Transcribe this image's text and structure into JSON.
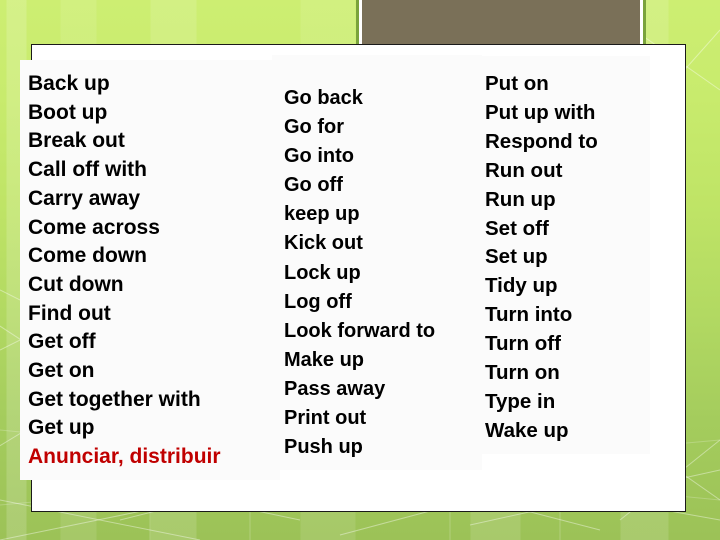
{
  "slide": {
    "background_color": "#bfe466",
    "panel_color": "#ffffff",
    "panel_border_color": "#1a1a1a",
    "accent_color": "#c00000",
    "decoration_fill": "#7a7058",
    "decoration_border": "#7aa33c"
  },
  "columns": [
    {
      "id": "column-1",
      "items": [
        {
          "text": "Back up",
          "style": "normal"
        },
        {
          "text": "Boot up",
          "style": "normal"
        },
        {
          "text": "Break out",
          "style": "normal"
        },
        {
          "text": "Call off with",
          "style": "normal"
        },
        {
          "text": "Carry away",
          "style": "normal"
        },
        {
          "text": "Come across",
          "style": "normal"
        },
        {
          "text": "Come down",
          "style": "normal"
        },
        {
          "text": "Cut down",
          "style": "normal"
        },
        {
          "text": "Find out",
          "style": "normal"
        },
        {
          "text": "Get off",
          "style": "normal"
        },
        {
          "text": "Get on",
          "style": "normal"
        },
        {
          "text": "Get together with",
          "style": "normal"
        },
        {
          "text": "Get up",
          "style": "normal"
        },
        {
          "text": "Anunciar, distribuir",
          "style": "accent"
        }
      ]
    },
    {
      "id": "column-2",
      "items": [
        {
          "text": "Go back",
          "style": "normal"
        },
        {
          "text": "Go for",
          "style": "normal"
        },
        {
          "text": "Go into",
          "style": "normal"
        },
        {
          "text": "Go off",
          "style": "normal"
        },
        {
          "text": "keep up",
          "style": "normal"
        },
        {
          "text": "Kick out",
          "style": "normal"
        },
        {
          "text": "Lock up",
          "style": "normal"
        },
        {
          "text": "Log off",
          "style": "normal"
        },
        {
          "text": "Look forward to",
          "style": "normal"
        },
        {
          "text": "Make up",
          "style": "normal"
        },
        {
          "text": "Pass away",
          "style": "normal"
        },
        {
          "text": "Print out",
          "style": "normal"
        },
        {
          "text": "Push up",
          "style": "normal"
        }
      ]
    },
    {
      "id": "column-3",
      "items": [
        {
          "text": "Put on",
          "style": "normal"
        },
        {
          "text": "Put up with",
          "style": "normal"
        },
        {
          "text": "Respond to",
          "style": "normal"
        },
        {
          "text": "Run out",
          "style": "normal"
        },
        {
          "text": "Run up",
          "style": "normal"
        },
        {
          "text": "Set off",
          "style": "normal"
        },
        {
          "text": "Set up",
          "style": "normal"
        },
        {
          "text": "Tidy up",
          "style": "normal"
        },
        {
          "text": "Turn into",
          "style": "normal"
        },
        {
          "text": "Turn off",
          "style": "normal"
        },
        {
          "text": "Turn on",
          "style": "normal"
        },
        {
          "text": "Type in",
          "style": "normal"
        },
        {
          "text": "Wake up",
          "style": "normal"
        }
      ]
    }
  ]
}
